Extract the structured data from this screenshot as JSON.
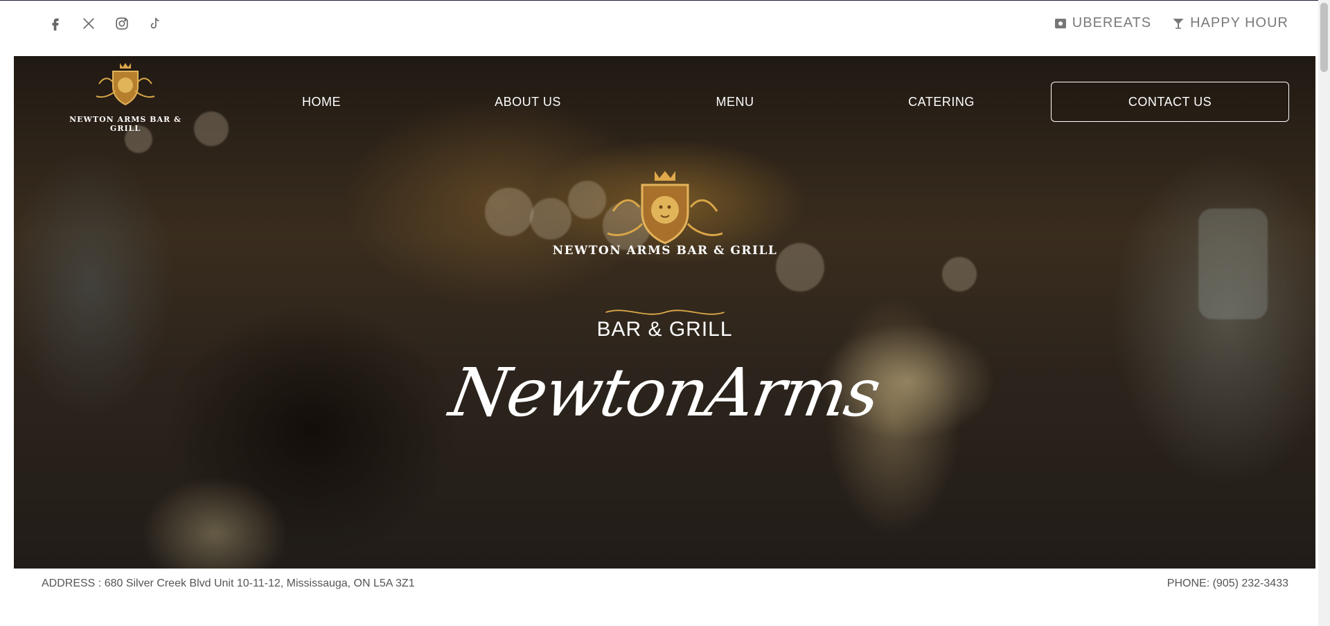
{
  "social": {
    "icons": [
      "facebook-icon",
      "x-icon",
      "instagram-icon",
      "tiktok-icon"
    ]
  },
  "utility": {
    "ubereats_label": "UBEREATS",
    "happy_hour_label": "HAPPY HOUR"
  },
  "nav": {
    "logo_text": "NEWTON ARMS BAR & GRILL",
    "items": [
      {
        "label": "HOME"
      },
      {
        "label": "ABOUT US"
      },
      {
        "label": "MENU"
      },
      {
        "label": "CATERING"
      }
    ],
    "contact_label": "CONTACT US"
  },
  "hero": {
    "logo_text": "NEWTON ARMS BAR & GRILL",
    "tagline": "BAR & GRILL",
    "script_title": "NewtonArms"
  },
  "footer": {
    "address": "ADDRESS : 680 Silver Creek Blvd Unit 10-11-12, Mississauga, ON L5A 3Z1",
    "phone": "PHONE: (905) 232-3433"
  },
  "colors": {
    "gold": "#c9953a",
    "text_gray": "#7a7a7a"
  }
}
